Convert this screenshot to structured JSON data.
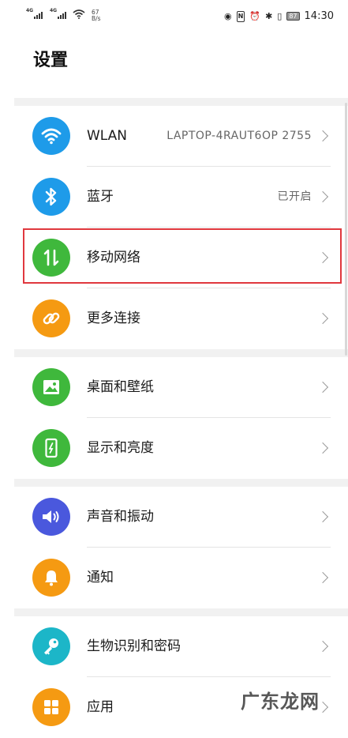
{
  "statusbar": {
    "signal1_tag": "4G",
    "signal2_tag": "4G",
    "speed_value": "67",
    "speed_unit": "B/s",
    "battery": "87",
    "time": "14:30"
  },
  "page": {
    "title": "设置"
  },
  "groups": [
    [
      {
        "key": "wlan",
        "label": "WLAN",
        "value": "LAPTOP-4RAUT6OP 2755",
        "icon": "wifi-icon",
        "color": "#1e9be9"
      },
      {
        "key": "bluetooth",
        "label": "蓝牙",
        "value": "已开启",
        "icon": "bluetooth-icon",
        "color": "#1e9be9"
      },
      {
        "key": "mobile-network",
        "label": "移动网络",
        "value": "",
        "icon": "mobile-data-icon",
        "color": "#3fb83c",
        "highlighted": true
      },
      {
        "key": "more-connections",
        "label": "更多连接",
        "value": "",
        "icon": "link-icon",
        "color": "#f59a12"
      }
    ],
    [
      {
        "key": "wallpaper",
        "label": "桌面和壁纸",
        "value": "",
        "icon": "image-icon",
        "color": "#3fb83c"
      },
      {
        "key": "display",
        "label": "显示和亮度",
        "value": "",
        "icon": "phone-brightness-icon",
        "color": "#3fb83c"
      }
    ],
    [
      {
        "key": "sound",
        "label": "声音和振动",
        "value": "",
        "icon": "speaker-icon",
        "color": "#4a58dd"
      },
      {
        "key": "notifications",
        "label": "通知",
        "value": "",
        "icon": "bell-icon",
        "color": "#f59a12"
      }
    ],
    [
      {
        "key": "biometrics",
        "label": "生物识别和密码",
        "value": "",
        "icon": "key-icon",
        "color": "#1cb6c8"
      },
      {
        "key": "apps",
        "label": "应用",
        "value": "",
        "icon": "apps-grid-icon",
        "color": "#f59a12"
      }
    ]
  ],
  "watermark": {
    "text": "广东龙网"
  },
  "colors": {
    "highlight": "#e0383e",
    "chevron": "#9a9a9a",
    "section_gap": "#f1f1f1"
  }
}
